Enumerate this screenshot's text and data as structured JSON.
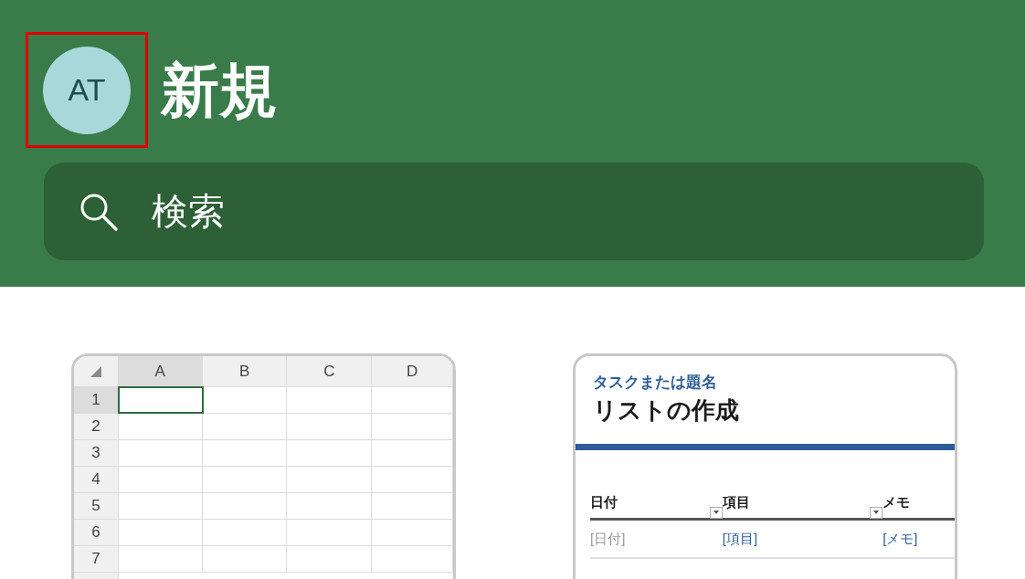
{
  "header": {
    "avatar": {
      "initials": "AT",
      "highlighted": true
    },
    "title": "新規",
    "search": {
      "placeholder": "検索"
    }
  },
  "templates": [
    {
      "kind": "blank-workbook",
      "columns": [
        {
          "label": "A",
          "selected": true
        },
        {
          "label": "B",
          "selected": false
        },
        {
          "label": "C",
          "selected": false
        },
        {
          "label": "D",
          "selected": false
        }
      ],
      "rows": [
        {
          "label": "1",
          "selected": true
        },
        {
          "label": "2",
          "selected": false
        },
        {
          "label": "3",
          "selected": false
        },
        {
          "label": "4",
          "selected": false
        },
        {
          "label": "5",
          "selected": false
        },
        {
          "label": "6",
          "selected": false
        },
        {
          "label": "7",
          "selected": false
        }
      ]
    },
    {
      "kind": "list",
      "subtitle": "タスクまたは題名",
      "title": "リストの作成",
      "columns": [
        {
          "label": "日付",
          "filter": true
        },
        {
          "label": "項目",
          "filter": true
        },
        {
          "label": "メモ",
          "filter": false
        }
      ],
      "cells": [
        {
          "text": "[日付]",
          "muted": true
        },
        {
          "text": "[項目]",
          "muted": false
        },
        {
          "text": "[メモ]",
          "muted": false
        }
      ]
    }
  ]
}
